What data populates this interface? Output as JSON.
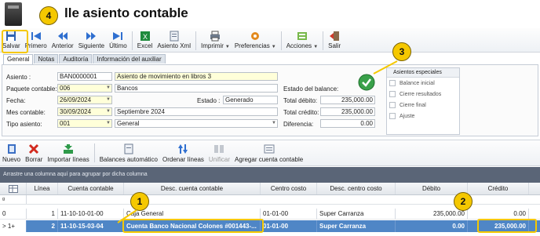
{
  "window": {
    "title": "lle asiento contable"
  },
  "toolbar": {
    "items": [
      {
        "label": "Salvar"
      },
      {
        "label": "Primero"
      },
      {
        "label": "Anterior"
      },
      {
        "label": "Siguiente"
      },
      {
        "label": "Último"
      },
      {
        "label": "Excel"
      },
      {
        "label": "Asiento Xml"
      },
      {
        "label": "Imprimir"
      },
      {
        "label": "Preferencias"
      },
      {
        "label": "Acciones"
      },
      {
        "label": "Salir"
      }
    ]
  },
  "tabs": [
    "General",
    "Notas",
    "Auditoría",
    "Información del auxiliar"
  ],
  "form": {
    "asiento": {
      "label": "Asiento :",
      "value": "BAN0000001",
      "description": "Asiento de movimiento en libros 3"
    },
    "paquete": {
      "label": "Paquete contable:",
      "value": "006",
      "description": "Bancos"
    },
    "fecha": {
      "label": "Fecha:",
      "value": "26/09/2024"
    },
    "estado": {
      "label": "Estado :",
      "value": "Generado"
    },
    "mes": {
      "label": "Mes contable:",
      "value": "30/09/2024",
      "description": "Septiembre 2024"
    },
    "tipo": {
      "label": "Tipo asiento:",
      "value": "001",
      "description": "General"
    },
    "balance": {
      "label": "Estado del balance:"
    },
    "total_debito": {
      "label": "Total débito:",
      "value": "235,000.00"
    },
    "total_credito": {
      "label": "Total crédito:",
      "value": "235,000.00"
    },
    "diferencia": {
      "label": "Diferencia:",
      "value": "0.00"
    }
  },
  "special": {
    "title": "Asientos especiales",
    "options": [
      "Balance inicial",
      "Cierre resultados",
      "Cierre final",
      "Ajuste"
    ]
  },
  "lines_toolbar": {
    "items": [
      {
        "label": "Nuevo"
      },
      {
        "label": "Borrar"
      },
      {
        "label": "Importar líneas"
      },
      {
        "label": "Balances automático"
      },
      {
        "label": "Ordenar líneas"
      },
      {
        "label": "Unificar"
      },
      {
        "label": "Agregar cuenta contable"
      }
    ]
  },
  "group_hint": "Arrastre una columna aquí para agrupar por dicha columna",
  "grid": {
    "columns": [
      "Línea",
      "Cuenta contable",
      "Desc. cuenta contable",
      "Centro costo",
      "Desc. centro costo",
      "Débito",
      "Crédito"
    ],
    "filter_icon": "ᵍ",
    "rows": [
      {
        "marker": "0",
        "linea": "1",
        "cuenta": "11-10-10-01-00",
        "desc": "Caja General",
        "centro": "01-01-00",
        "desc_centro": "Super Carranza",
        "debito": "235,000.00",
        "credito": "0.00"
      },
      {
        "marker": "> 1+",
        "linea": "2",
        "cuenta": "11-10-15-03-04",
        "desc": "Cuenta Banco Nacional Colones #001443-...",
        "centro": "01-01-00",
        "desc_centro": "Super Carranza",
        "debito": "0.00",
        "credito": "235,000.00"
      }
    ]
  },
  "callouts": [
    "1",
    "2",
    "3",
    "4"
  ],
  "colors": {
    "accent": "#f5c800",
    "selection": "#4f86c6",
    "group_bar": "#5a6577"
  }
}
